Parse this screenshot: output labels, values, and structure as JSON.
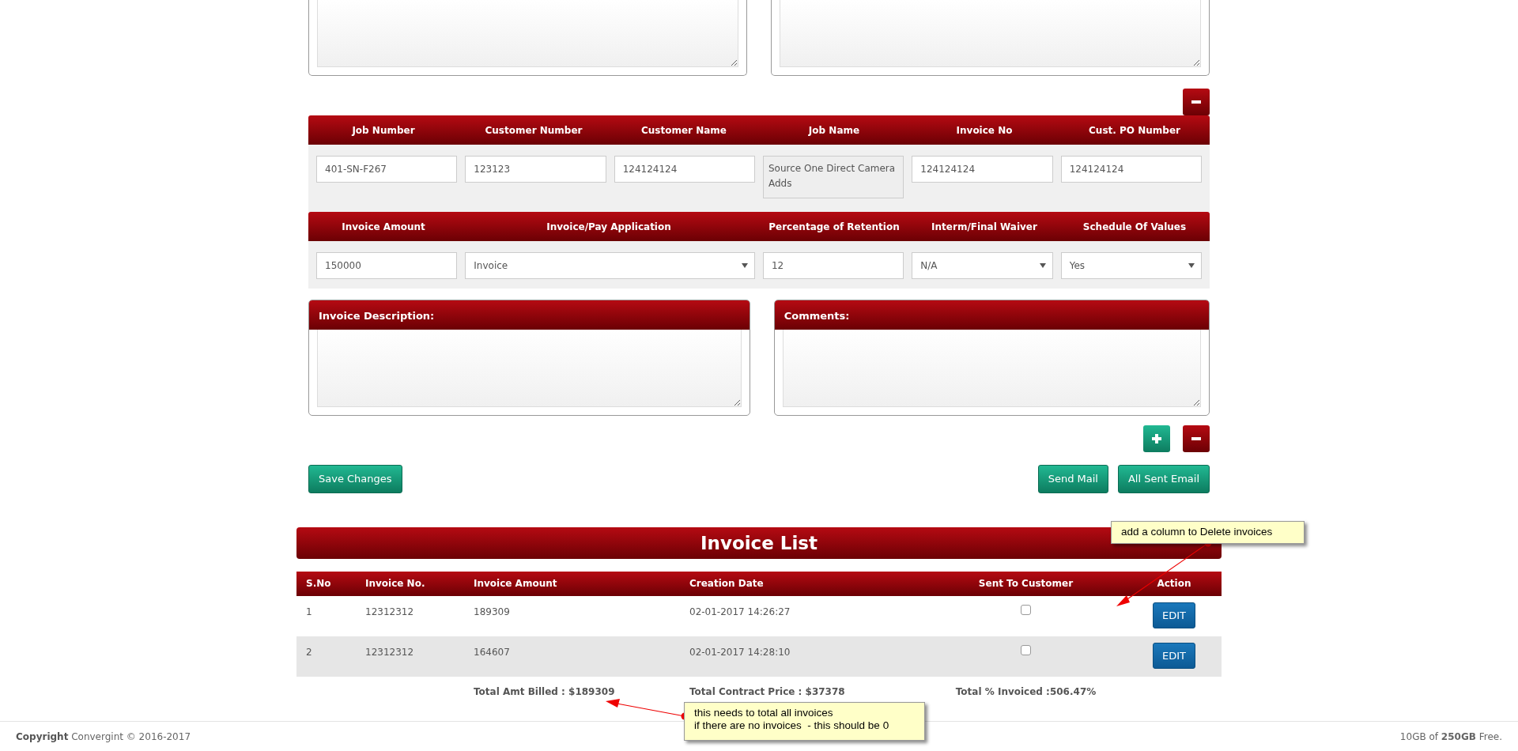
{
  "job_fields": [
    {
      "label": "Job Number",
      "value": "401-SN-F267",
      "kind": "input",
      "disabled": false
    },
    {
      "label": "Customer Number",
      "value": "123123",
      "kind": "input",
      "disabled": false
    },
    {
      "label": "Customer Name",
      "value": "124124124",
      "kind": "input",
      "disabled": false
    },
    {
      "label": "Job Name",
      "value": "Source One Direct Camera Adds",
      "kind": "textarea",
      "disabled": true
    },
    {
      "label": "Invoice No",
      "value": "124124124",
      "kind": "input",
      "disabled": false
    },
    {
      "label": "Cust. PO Number",
      "value": "124124124",
      "kind": "input",
      "disabled": false
    }
  ],
  "invoice_fields": [
    {
      "label": "Invoice Amount",
      "value": "150000",
      "kind": "input",
      "wide": false
    },
    {
      "label": "Invoice/Pay Application",
      "value": "Invoice",
      "kind": "select",
      "wide": true
    },
    {
      "label": "Percentage of Retention",
      "value": "12",
      "kind": "input",
      "wide": false
    },
    {
      "label": "Interm/Final Waiver",
      "value": "N/A",
      "kind": "select",
      "wide": false
    },
    {
      "label": "Schedule Of Values",
      "value": "Yes",
      "kind": "select",
      "wide": false
    }
  ],
  "note_panels": [
    {
      "title": "Invoice Description:"
    },
    {
      "title": "Comments:"
    }
  ],
  "save_button": "Save Changes",
  "mail_buttons": [
    "Send Mail",
    "All Sent Email"
  ],
  "invoice_list": {
    "title": "Invoice List",
    "columns": [
      "S.No",
      "Invoice No.",
      "Invoice Amount",
      "Creation Date",
      "Sent To Customer",
      "Action"
    ],
    "rows": [
      {
        "cells": [
          "1",
          "12312312",
          "189309",
          "02-01-2017 14:26:27"
        ],
        "sent": false,
        "action": "EDIT"
      },
      {
        "cells": [
          "2",
          "12312312",
          "164607",
          "02-01-2017 14:28:10"
        ],
        "sent": false,
        "action": "EDIT"
      }
    ],
    "totals": [
      "Total Amt Billed : $189309",
      "Total Contract Price : $37378",
      "Total % Invoiced :506.47%"
    ]
  },
  "annotations": [
    {
      "lines": [
        "add a column to Delete invoices"
      ]
    },
    {
      "lines": [
        "this needs to total all invoices",
        "if there are no invoices  - this should be 0"
      ]
    }
  ],
  "footer": {
    "copyright_label": "Copyright",
    "copyright_text": "Convergint © 2016-2017",
    "storage": "10GB of **250GB** Free."
  }
}
